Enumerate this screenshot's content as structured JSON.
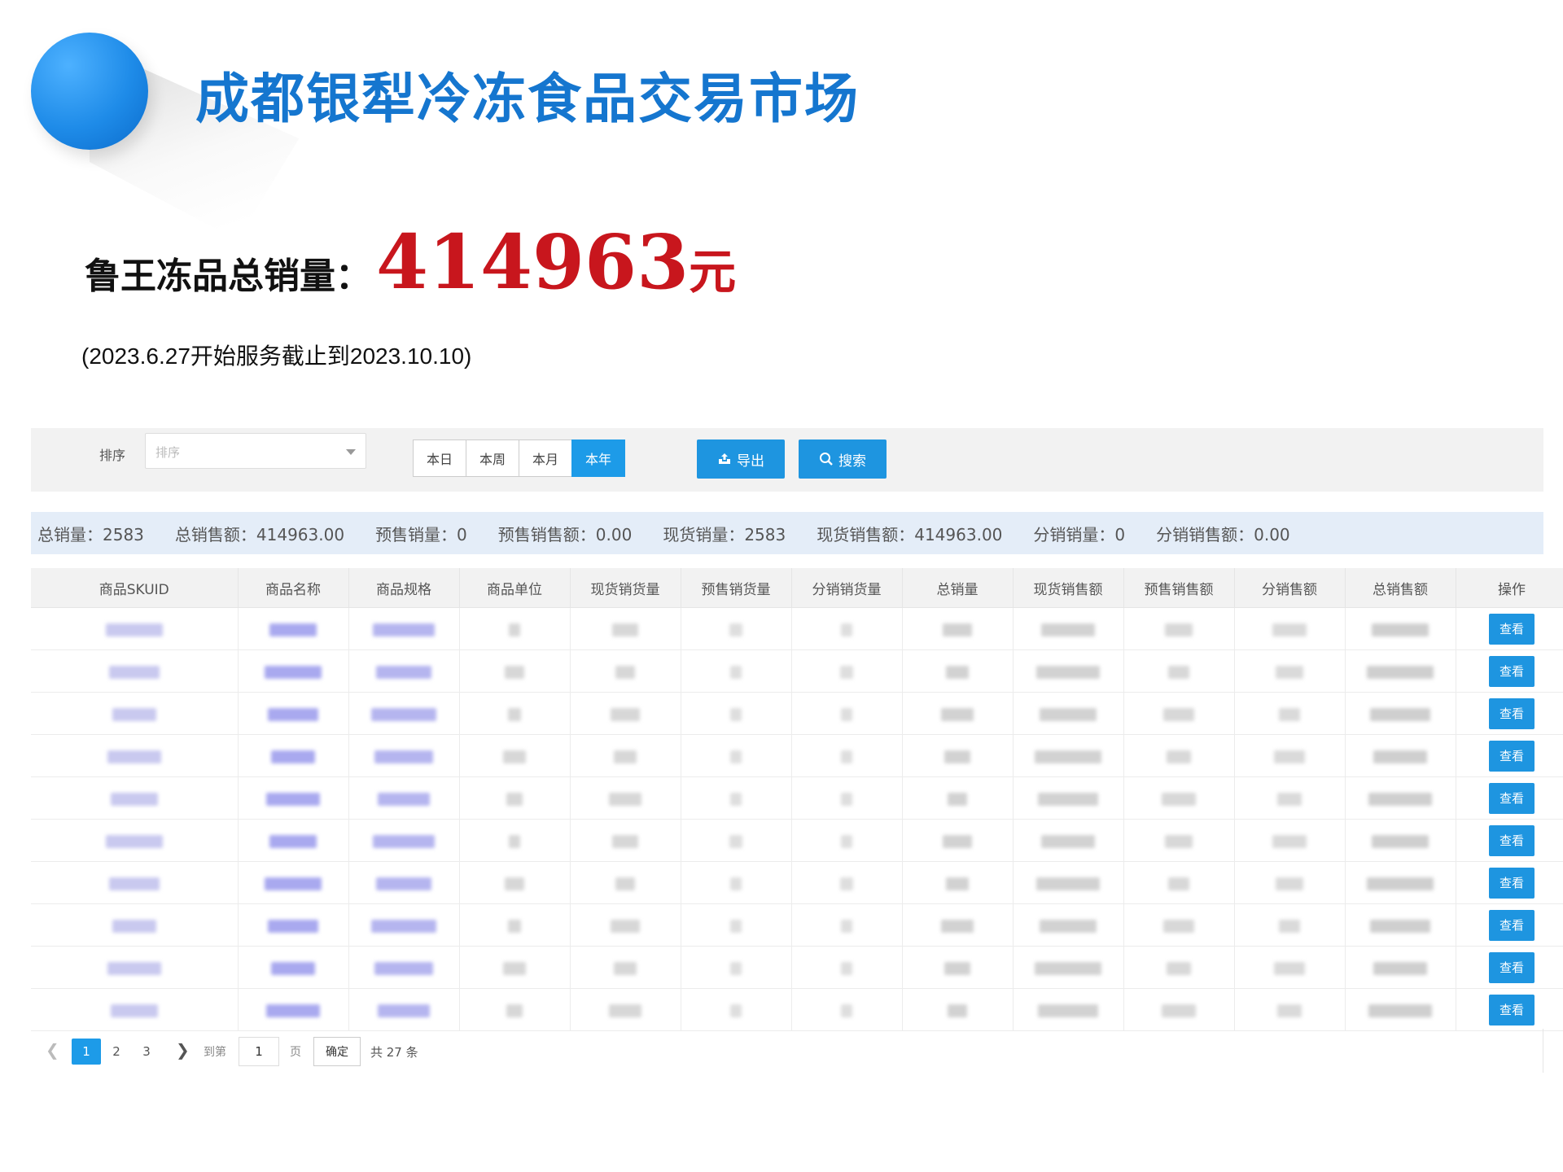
{
  "header": {
    "market_title": "成都银犁冷冻食品交易市场",
    "total_label": "鲁王冻品总销量：",
    "total_amount": "414963",
    "total_unit": "元",
    "period_note": "(2023.6.27开始服务截止到2023.10.10)"
  },
  "toolbar": {
    "sort_label": "排序",
    "sort_placeholder": "排序",
    "ranges": [
      "本日",
      "本周",
      "本月",
      "本年"
    ],
    "active_range": "本年",
    "export_label": "导出",
    "search_label": "搜索"
  },
  "stats": [
    "总销量：2583",
    "总销售额：414963.00",
    "预售销量：0",
    "预售销售额：0.00",
    "现货销量：2583",
    "现货销售额：414963.00",
    "分销销量：0",
    "分销销售额：0.00"
  ],
  "table": {
    "columns": [
      "商品SKUID",
      "商品名称",
      "商品规格",
      "商品单位",
      "现货销货量",
      "预售销货量",
      "分销销货量",
      "总销量",
      "现货销售额",
      "预售销售额",
      "分销售额",
      "总销售额",
      "操作"
    ],
    "row_count": 10,
    "view_label": "查看"
  },
  "pagination": {
    "pages": [
      "1",
      "2",
      "3"
    ],
    "current_page": "1",
    "goto_prefix": "到第",
    "goto_value": "1",
    "goto_suffix": "页",
    "confirm_label": "确定",
    "total_text": "共 27 条"
  },
  "colors": {
    "accent": "#1e95e0",
    "title_blue": "#1576cf",
    "amount_red": "#c8161d"
  }
}
